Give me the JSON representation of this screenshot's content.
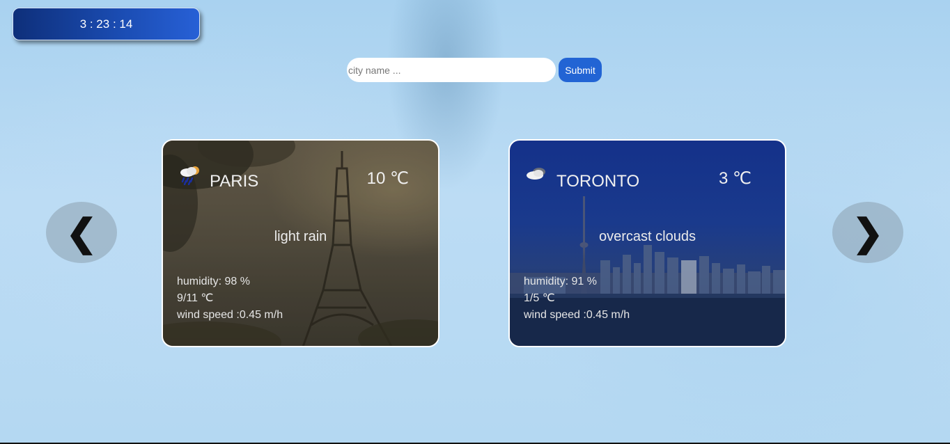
{
  "clock": {
    "time": "3 : 23 : 14"
  },
  "search": {
    "placeholder": "city name ...",
    "submit_label": "Submit"
  },
  "nav": {
    "prev": "❮",
    "next": "❯"
  },
  "cards": [
    {
      "city": "PARIS",
      "temp": "10 ℃",
      "description": "light rain",
      "humidity": "humidity: 98 %",
      "minmax": "9/11 ℃",
      "wind": "wind speed :0.45 m/h",
      "icon": "light-rain-icon"
    },
    {
      "city": "TORONTO",
      "temp": "3 ℃",
      "description": "overcast clouds",
      "humidity": "humidity: 91 %",
      "minmax": "1/5 ℃",
      "wind": "wind speed :0.45 m/h",
      "icon": "overcast-clouds-icon"
    }
  ],
  "colors": {
    "clock_bg": "#1a4bb0",
    "submit_bg": "#2264d4",
    "page_bg": "#b4d8f2"
  }
}
